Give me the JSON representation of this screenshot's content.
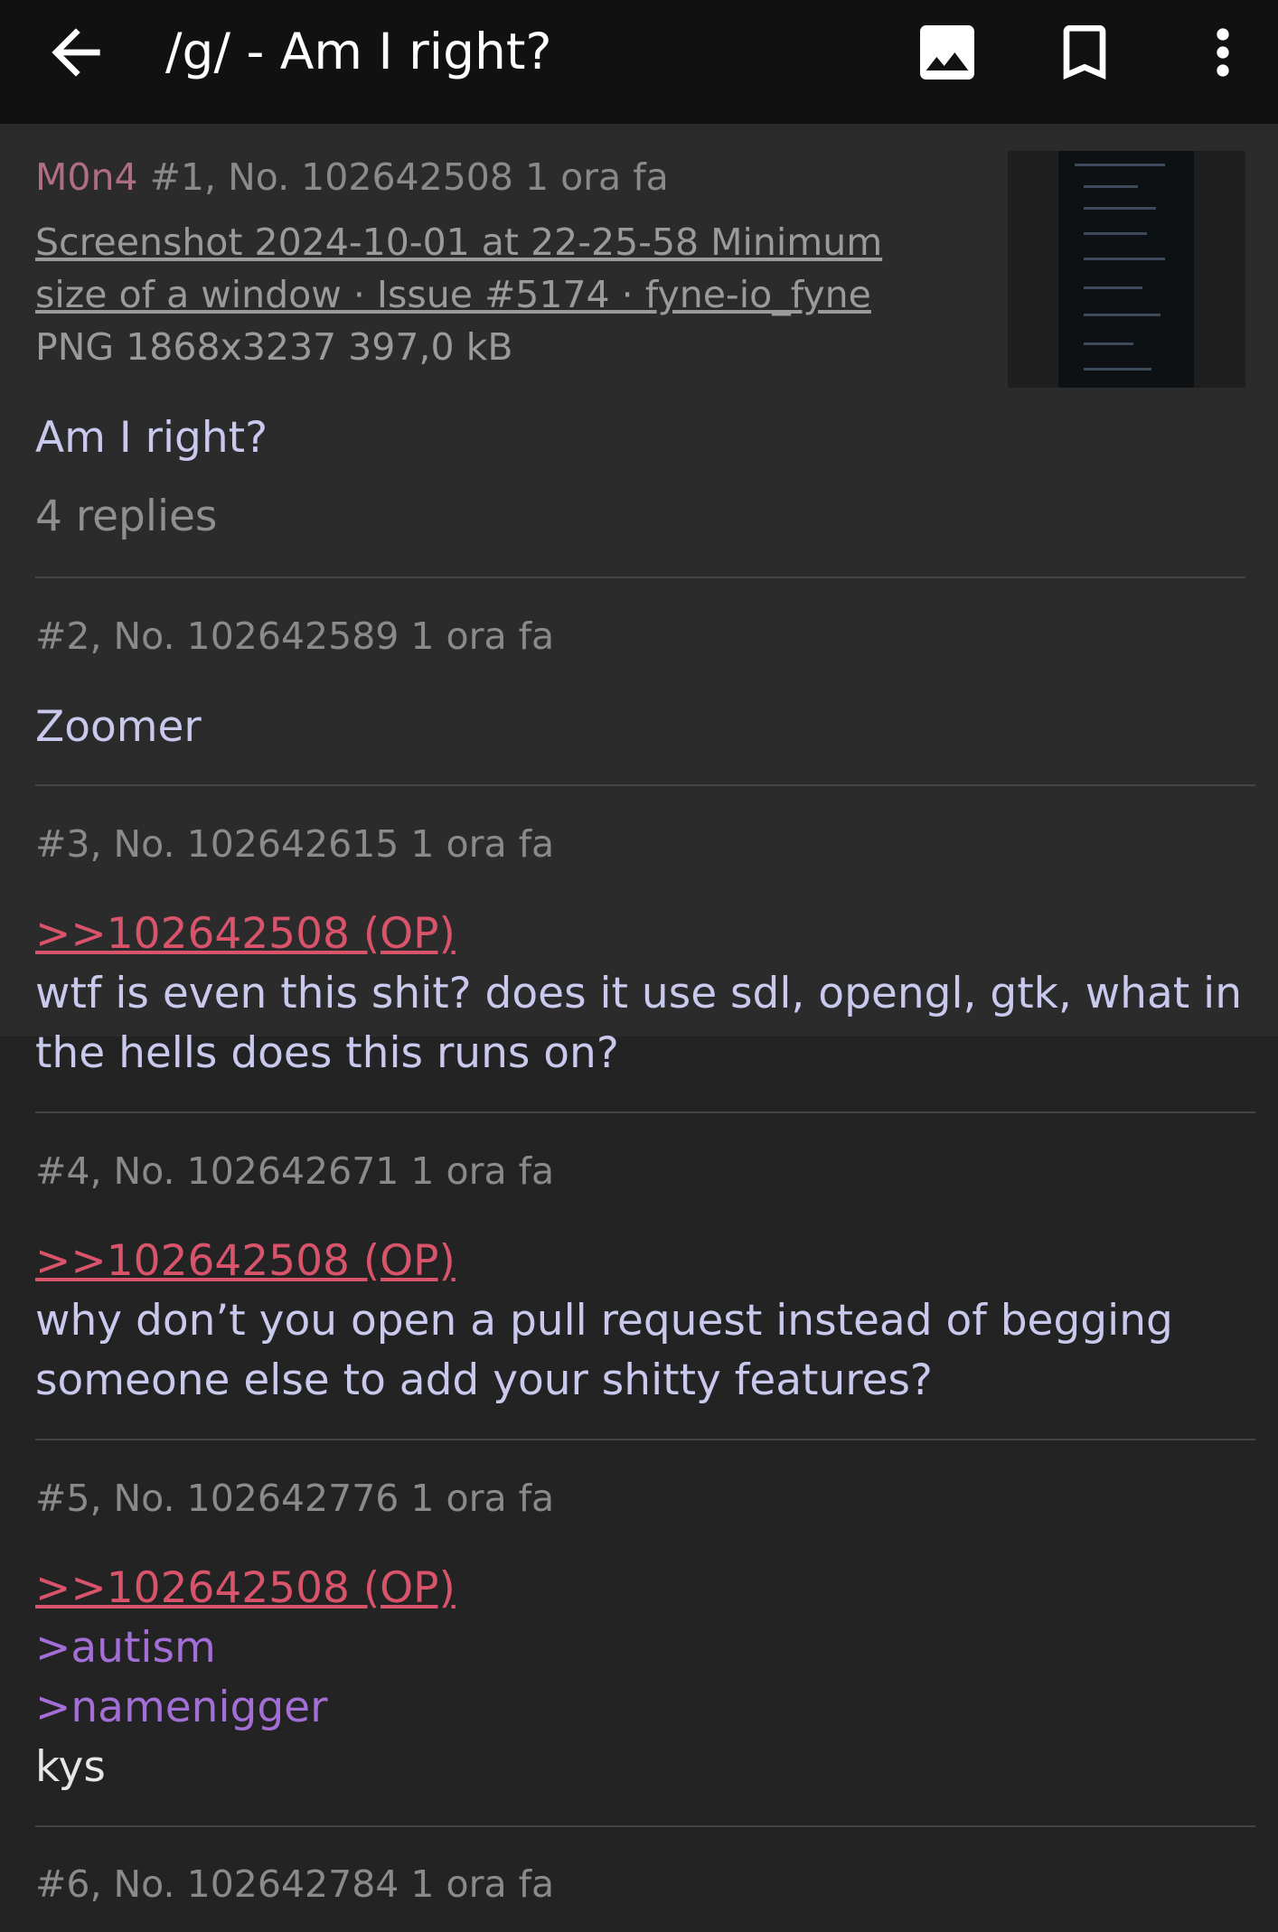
{
  "header": {
    "title": "/g/ - Am I right?",
    "icons": [
      "back-arrow-icon",
      "image-icon",
      "bookmark-icon",
      "more-vertical-icon"
    ]
  },
  "op": {
    "name": "M0n4",
    "meta": "#1, No. 102642508 1 ora fa",
    "file_name_line1": "Screenshot 2024-10-01 at 22-25-58 Minimum",
    "file_name_line2": "size of a window · Issue #5174 · fyne-io_fyne",
    "file_info": "PNG 1868x3237 397,0 kB",
    "comment": "Am I right?",
    "replies": "4 replies"
  },
  "posts": [
    {
      "meta": "#2, No. 102642589 1 ora fa",
      "lines": [
        "Zoomer"
      ]
    },
    {
      "meta": "#3, No. 102642615 1 ora fa",
      "quote": ">>102642508 (OP)",
      "lines": [
        "wtf is even this shit? does it use sdl, opengl, gtk, what in",
        "the hells does this runs on?"
      ]
    },
    {
      "meta": "#4, No. 102642671 1 ora fa",
      "quote": ">>102642508 (OP)",
      "lines": [
        "why don’t you open a pull request instead of begging",
        "someone else to add your shitty features?"
      ]
    },
    {
      "meta": "#5, No. 102642776 1 ora fa",
      "quote": ">>102642508 (OP)",
      "greentext": [
        ">autism",
        ">namenigger"
      ],
      "lines": [
        "kys"
      ]
    },
    {
      "meta": "#6, No. 102642784 1 ora fa"
    }
  ],
  "colors": {
    "background": "#232323",
    "topbar": "#111111",
    "op_card": "#2b2b2b",
    "name": "#b06e84",
    "quote_link": "#d9536b",
    "greentext": "#a36fd6"
  }
}
